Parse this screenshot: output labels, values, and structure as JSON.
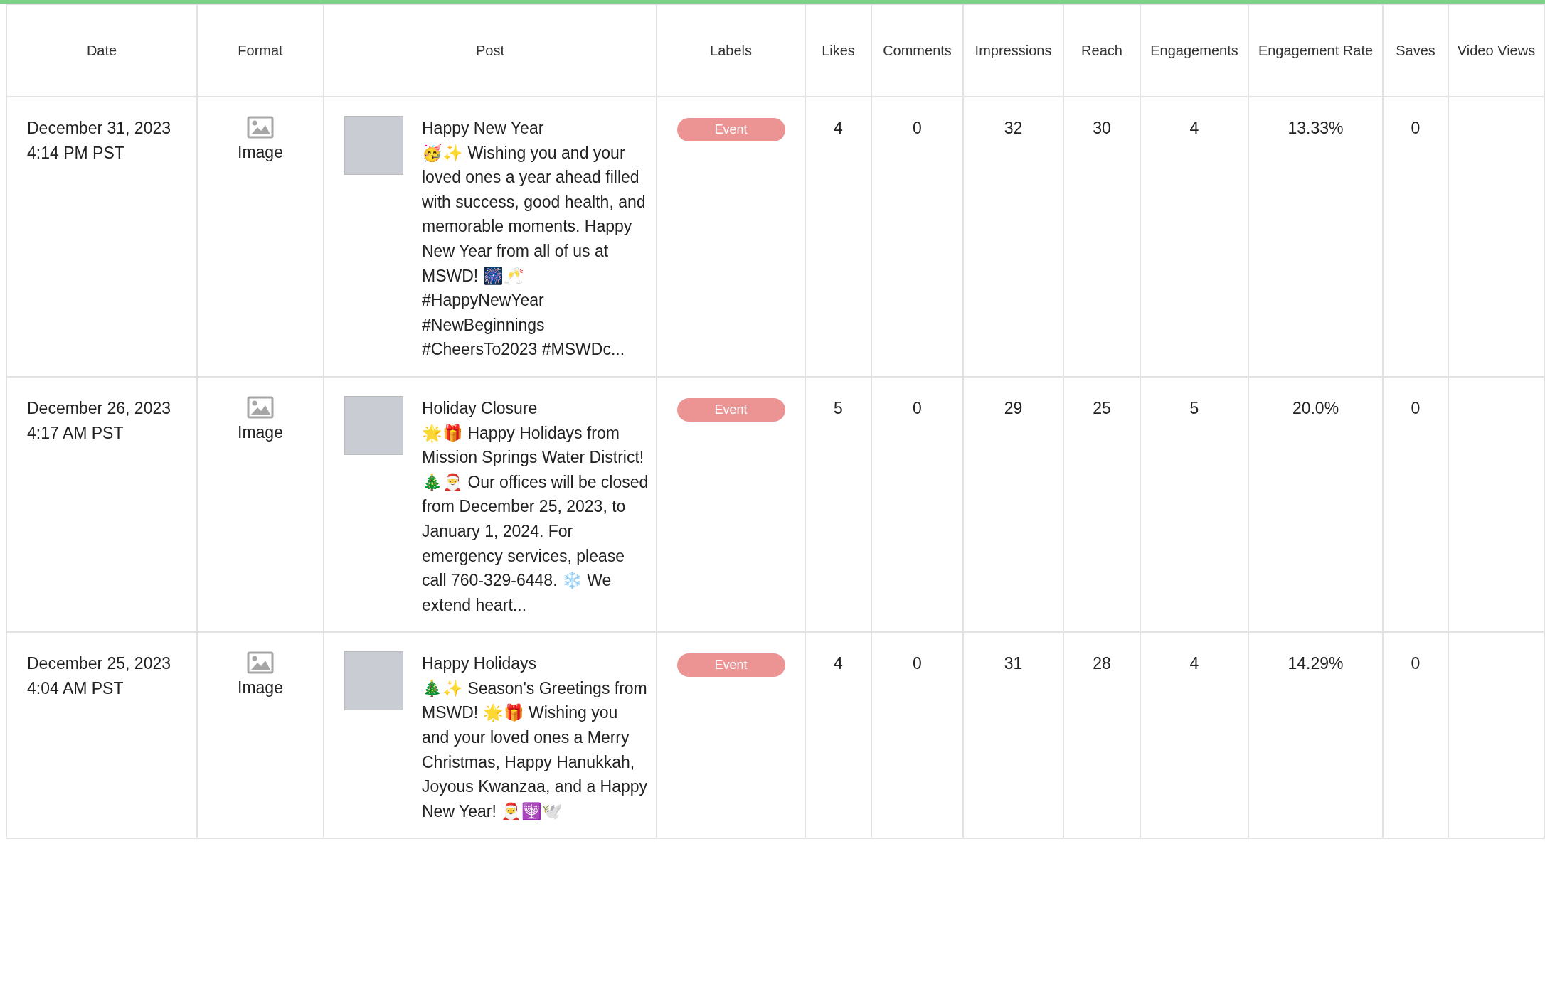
{
  "table": {
    "columns": [
      "Date",
      "Format",
      "Post",
      "Labels",
      "Likes",
      "Comments",
      "Impressions",
      "Reach",
      "Engagements",
      "Engagement Rate",
      "Saves",
      "Video Views"
    ],
    "rows": [
      {
        "date": "December 31, 2023",
        "time": "4:14 PM PST",
        "format": "Image",
        "post_title": "Happy New Year",
        "post_text": "🥳✨ Wishing you and your loved ones a year ahead filled with success, good health, and memorable moments. Happy New Year from all of us at MSWD! 🎆🥂 #HappyNewYear #NewBeginnings #CheersTo2023 #MSWDc...",
        "labels": [
          {
            "text": "Event",
            "color": "#ec9494"
          }
        ],
        "likes": "4",
        "comments": "0",
        "impressions": "32",
        "reach": "30",
        "engagements": "4",
        "engagement_rate": "13.33%",
        "saves": "0"
      },
      {
        "date": "December 26, 2023",
        "time": "4:17 AM PST",
        "format": "Image",
        "post_title": "Holiday Closure",
        "post_text": "🌟🎁 Happy Holidays from Mission Springs Water District! 🎄🎅 Our offices will be closed from December 25, 2023, to January 1, 2024. For emergency services, please call 760-329-6448. ❄️ We extend heart...",
        "labels": [
          {
            "text": "Event",
            "color": "#ec9494"
          }
        ],
        "likes": "5",
        "comments": "0",
        "impressions": "29",
        "reach": "25",
        "engagements": "5",
        "engagement_rate": "20.0%",
        "saves": "0"
      },
      {
        "date": "December 25, 2023",
        "time": "4:04 AM PST",
        "format": "Image",
        "post_title": "Happy Holidays",
        "post_text": "🎄✨ Season's Greetings from MSWD! 🌟🎁 Wishing you and your loved ones a Merry Christmas, Happy Hanukkah, Joyous Kwanzaa, and a Happy New Year! 🎅🕎🕊️",
        "labels": [
          {
            "text": "Event",
            "color": "#ec9494"
          }
        ],
        "likes": "4",
        "comments": "0",
        "impressions": "31",
        "reach": "28",
        "engagements": "4",
        "engagement_rate": "14.29%",
        "saves": "0"
      }
    ]
  }
}
